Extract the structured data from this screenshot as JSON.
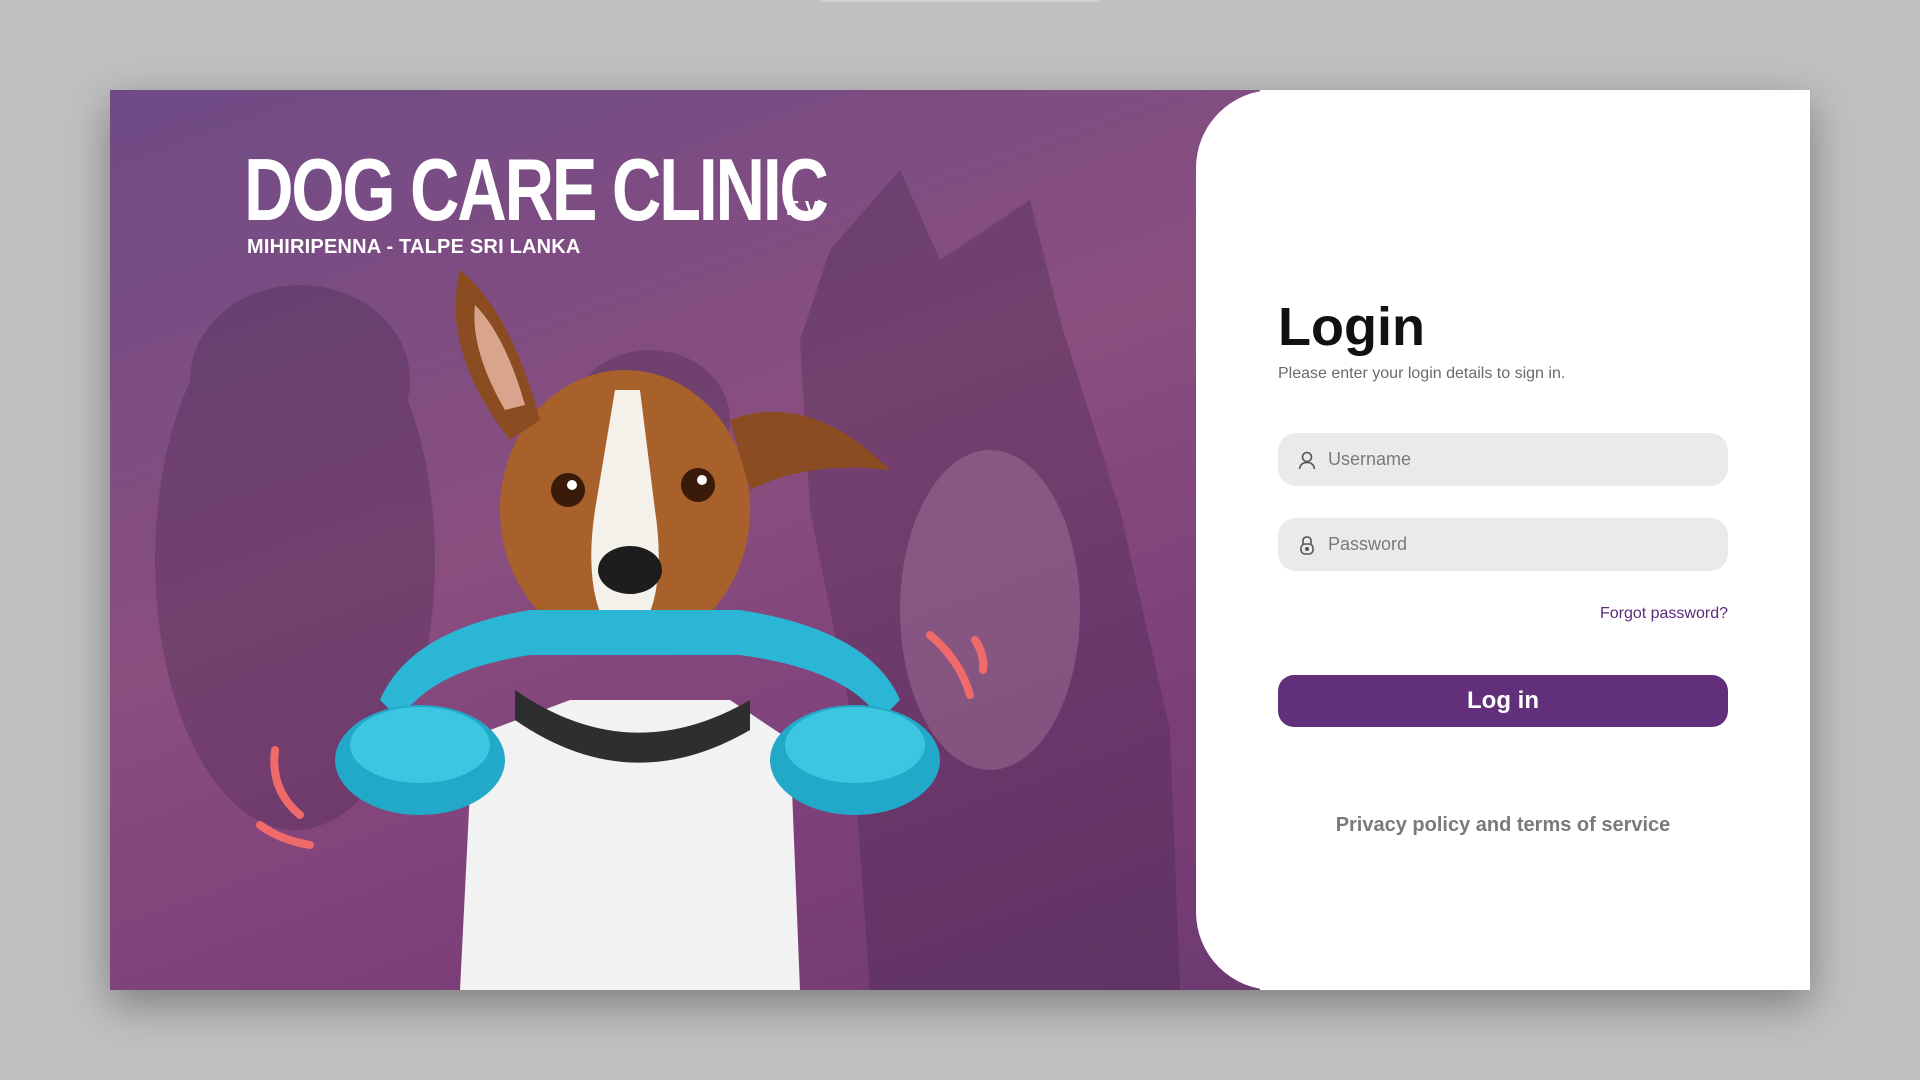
{
  "brand": {
    "title": "DOG CARE CLINIC",
    "suffix": "E.V.",
    "subtitle": "MIHIRIPENNA - TALPE SRI LANKA"
  },
  "login": {
    "title": "Login",
    "subtitle": "Please enter your login details to sign in.",
    "username_placeholder": "Username",
    "password_placeholder": "Password",
    "forgot_label": "Forgot password?",
    "submit_label": "Log in",
    "privacy_label": "Privacy policy and terms of service"
  },
  "icons": {
    "username": "user-icon",
    "password": "lock-icon"
  },
  "colors": {
    "accent": "#62307a",
    "link": "#5a2a78",
    "hero_overlay": "#7d4a86",
    "phone": "#2bb6d6",
    "ring_marks": "#f06a6a"
  }
}
